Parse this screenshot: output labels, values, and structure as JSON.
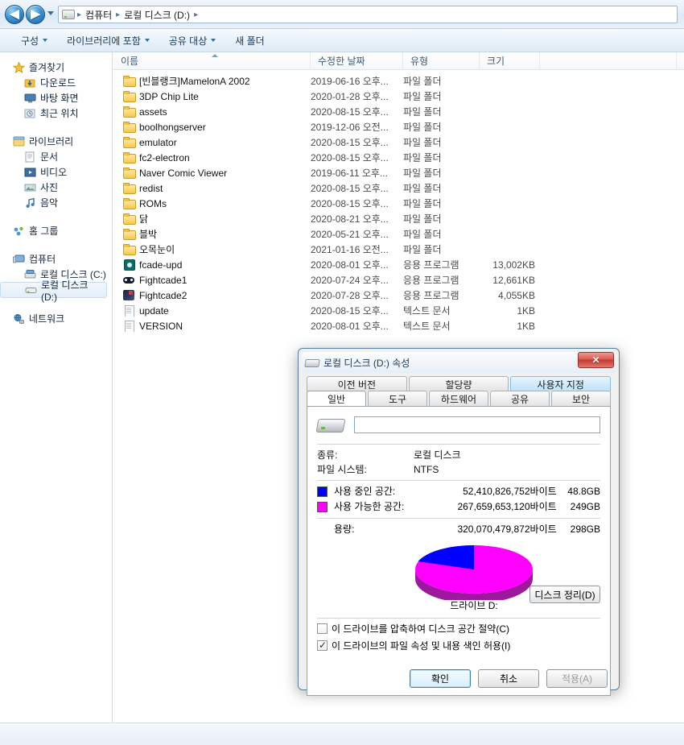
{
  "explorer": {
    "nav": {
      "back_label": "◀",
      "forward_label": "▶",
      "breadcrumb": [
        "컴퓨터",
        "로컬 디스크 (D:)"
      ],
      "separator": "▸"
    },
    "toolbar": [
      {
        "label": "구성",
        "caret": true
      },
      {
        "label": "라이브러리에 포함",
        "caret": true
      },
      {
        "label": "공유 대상",
        "caret": true
      },
      {
        "label": "새 폴더",
        "caret": false
      }
    ],
    "sidebar": [
      {
        "label": "즐겨찾기",
        "icon": "star-icon",
        "child": false,
        "selected": false
      },
      {
        "label": "다운로드",
        "icon": "download-icon",
        "child": true,
        "selected": false
      },
      {
        "label": "바탕 화면",
        "icon": "desktop-icon",
        "child": true,
        "selected": false
      },
      {
        "label": "최근 위치",
        "icon": "recent-icon",
        "child": true,
        "selected": false
      },
      {
        "label": "라이브러리",
        "icon": "library-icon",
        "child": false,
        "selected": false
      },
      {
        "label": "문서",
        "icon": "documents-icon",
        "child": true,
        "selected": false
      },
      {
        "label": "비디오",
        "icon": "video-icon",
        "child": true,
        "selected": false
      },
      {
        "label": "사진",
        "icon": "pictures-icon",
        "child": true,
        "selected": false
      },
      {
        "label": "음악",
        "icon": "music-icon",
        "child": true,
        "selected": false
      },
      {
        "label": "홈 그룹",
        "icon": "homegroup-icon",
        "child": false,
        "selected": false
      },
      {
        "label": "컴퓨터",
        "icon": "computer-icon",
        "child": false,
        "selected": false
      },
      {
        "label": "로컬 디스크 (C:)",
        "icon": "system-drive-icon",
        "child": true,
        "selected": false
      },
      {
        "label": "로컬 디스크 (D:)",
        "icon": "drive-icon",
        "child": true,
        "selected": true
      },
      {
        "label": "네트워크",
        "icon": "network-icon",
        "child": false,
        "selected": false
      }
    ],
    "columns": {
      "name": "이름",
      "date": "수정한 날짜",
      "type": "유형",
      "size": "크기"
    },
    "files": [
      {
        "name": "[빈블랭크]MamelonA 2002",
        "date": "2019-06-16 오후...",
        "type": "파일 폴더",
        "size": "",
        "icon": "folder-icon"
      },
      {
        "name": "3DP Chip Lite",
        "date": "2020-01-28 오후...",
        "type": "파일 폴더",
        "size": "",
        "icon": "folder-icon"
      },
      {
        "name": "assets",
        "date": "2020-08-15 오후...",
        "type": "파일 폴더",
        "size": "",
        "icon": "folder-icon"
      },
      {
        "name": "boolhongserver",
        "date": "2019-12-06 오전...",
        "type": "파일 폴더",
        "size": "",
        "icon": "folder-icon"
      },
      {
        "name": "emulator",
        "date": "2020-08-15 오후...",
        "type": "파일 폴더",
        "size": "",
        "icon": "folder-icon"
      },
      {
        "name": "fc2-electron",
        "date": "2020-08-15 오후...",
        "type": "파일 폴더",
        "size": "",
        "icon": "folder-icon"
      },
      {
        "name": "Naver Comic Viewer",
        "date": "2019-06-11 오후...",
        "type": "파일 폴더",
        "size": "",
        "icon": "folder-icon"
      },
      {
        "name": "redist",
        "date": "2020-08-15 오후...",
        "type": "파일 폴더",
        "size": "",
        "icon": "folder-icon"
      },
      {
        "name": "ROMs",
        "date": "2020-08-15 오후...",
        "type": "파일 폴더",
        "size": "",
        "icon": "folder-icon"
      },
      {
        "name": "닭",
        "date": "2020-08-21 오후...",
        "type": "파일 폴더",
        "size": "",
        "icon": "folder-icon"
      },
      {
        "name": "블박",
        "date": "2020-05-21 오후...",
        "type": "파일 폴더",
        "size": "",
        "icon": "folder-icon"
      },
      {
        "name": "오목눈이",
        "date": "2021-01-16 오전...",
        "type": "파일 폴더",
        "size": "",
        "icon": "folder-icon"
      },
      {
        "name": "fcade-upd",
        "date": "2020-08-01 오후...",
        "type": "응용 프로그램",
        "size": "13,002KB",
        "icon": "gear-app-icon"
      },
      {
        "name": "Fightcade1",
        "date": "2020-07-24 오후...",
        "type": "응용 프로그램",
        "size": "12,661KB",
        "icon": "gamepad-app-icon"
      },
      {
        "name": "Fightcade2",
        "date": "2020-07-28 오후...",
        "type": "응용 프로그램",
        "size": "4,055KB",
        "icon": "fightcade2-app-icon"
      },
      {
        "name": "update",
        "date": "2020-08-15 오후...",
        "type": "텍스트 문서",
        "size": "1KB",
        "icon": "text-document-icon"
      },
      {
        "name": "VERSION",
        "date": "2020-08-01 오후...",
        "type": "텍스트 문서",
        "size": "1KB",
        "icon": "text-document-icon"
      }
    ]
  },
  "dialog": {
    "title": "로컬 디스크 (D:) 속성",
    "close_label": "✕",
    "tabs_row1": [
      {
        "label": "이전 버전",
        "state": "normal"
      },
      {
        "label": "할당량",
        "state": "normal"
      },
      {
        "label": "사용자 지정",
        "state": "highlight"
      }
    ],
    "tabs_row2": [
      {
        "label": "일반",
        "state": "active"
      },
      {
        "label": "도구",
        "state": "normal"
      },
      {
        "label": "하드웨어",
        "state": "normal"
      },
      {
        "label": "공유",
        "state": "normal"
      },
      {
        "label": "보안",
        "state": "normal"
      }
    ],
    "volume_label_value": "",
    "info": [
      {
        "key": "종류:",
        "value": "로컬 디스크"
      },
      {
        "key": "파일 시스템:",
        "value": "NTFS"
      }
    ],
    "space": [
      {
        "label": "사용 중인 공간:",
        "bytes": "52,410,826,752바이트",
        "gb": "48.8GB",
        "color": "#0000ff"
      },
      {
        "label": "사용 가능한 공간:",
        "bytes": "267,659,653,120바이트",
        "gb": "249GB",
        "color": "#ff00ff"
      }
    ],
    "capacity": {
      "label": "용량:",
      "bytes": "320,070,479,872바이트",
      "gb": "298GB"
    },
    "drive_caption": "드라이브 D:",
    "cleanup_button": "디스크 정리(D)",
    "checkboxes": [
      {
        "label": "이 드라이브를 압축하여 디스크 공간 절약(C)",
        "checked": false
      },
      {
        "label": "이 드라이브의 파일 속성 및 내용 색인 허용(I)",
        "checked": true
      }
    ],
    "buttons": [
      {
        "label": "확인",
        "style": "default"
      },
      {
        "label": "취소",
        "style": "normal"
      },
      {
        "label": "적용(A)",
        "style": "disabled"
      }
    ]
  },
  "chart_data": {
    "type": "pie",
    "title": "드라이브 D:",
    "labels": [
      "사용 중인 공간",
      "사용 가능한 공간"
    ],
    "values": [
      52410826752,
      267659653120
    ],
    "percentages": [
      16.4,
      83.6
    ],
    "display_values": [
      "48.8GB",
      "249GB"
    ],
    "colors": [
      "#0000ff",
      "#ff00ff"
    ],
    "legend_position": "above",
    "total": 320070479872,
    "total_display": "298GB"
  }
}
